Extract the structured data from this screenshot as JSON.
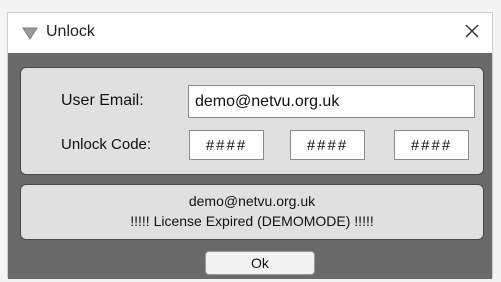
{
  "window": {
    "title": "Unlock",
    "icon": "chevron-down-icon",
    "close_icon": "close-icon"
  },
  "form": {
    "email_label": "User Email:",
    "email_value": "demo@netvu.org.uk",
    "code_label": "Unlock Code:",
    "code_values": [
      "####",
      "####",
      "####"
    ]
  },
  "status": {
    "line1": "demo@netvu.org.uk",
    "line2": "!!!!! License Expired (DEMOMODE) !!!!!"
  },
  "actions": {
    "ok_label": "Ok"
  },
  "colors": {
    "titlebar_bg": "#ffffff",
    "client_bg": "#6a6a6a",
    "panel_bg": "#e0e0e0",
    "panel_border": "#4a4a4a"
  }
}
